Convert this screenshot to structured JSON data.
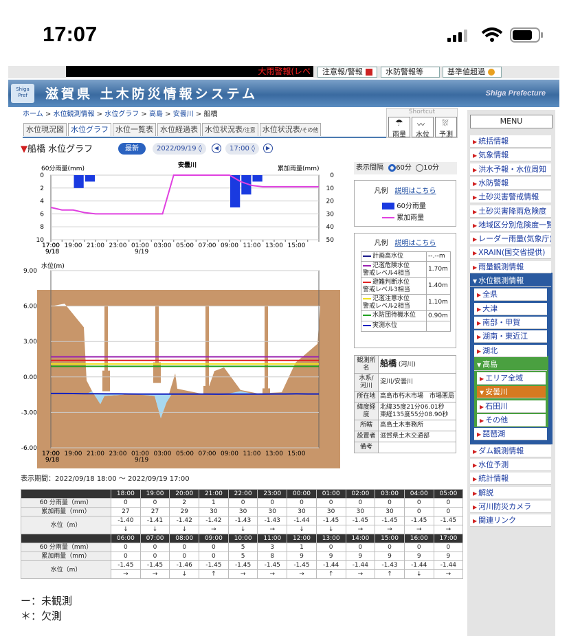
{
  "status": {
    "time": "17:07"
  },
  "topbar": {
    "ticker": "大雨警報(レベ",
    "buttons": [
      "注意報/警報",
      "水防警報等",
      "基準値超過"
    ]
  },
  "banner": {
    "logo": "Shiga Pref",
    "title": "滋賀県 土木防災情報システム",
    "pref": "Shiga Prefecture"
  },
  "breadcrumb": [
    "ホーム",
    "水位観測情報",
    "水位グラフ",
    "高島",
    "安曇川",
    "船橋"
  ],
  "tabs": [
    {
      "label": "水位現況図",
      "sub": ""
    },
    {
      "label": "水位グラフ",
      "sub": ""
    },
    {
      "label": "水位一覧表",
      "sub": ""
    },
    {
      "label": "水位経過表",
      "sub": ""
    },
    {
      "label": "水位状況表",
      "sub": "/注意"
    },
    {
      "label": "水位状況表",
      "sub": "/その他"
    }
  ],
  "shortcut": {
    "label": "Shortcut",
    "items": [
      "雨量",
      "水位",
      "予測"
    ]
  },
  "page": {
    "title": "船橋 水位グラフ",
    "latest": "最新",
    "date": "2022/09/19",
    "time": "17:00",
    "interval_label": "表示間隔",
    "interval_60": "60分",
    "interval_10": "10分"
  },
  "rain_legend": {
    "title": "凡例",
    "link": "説明はこちら",
    "items": [
      "60分雨量",
      "累加雨量"
    ]
  },
  "level_legend": {
    "title": "凡例",
    "link": "説明はこちら",
    "items": [
      {
        "name": "計画高水位",
        "value": "--.--m",
        "color": "#1a1a8a"
      },
      {
        "name": "氾濫危険水位\n警戒レベル4相当",
        "value": "1.70m",
        "color": "#9a20b0"
      },
      {
        "name": "避難判断水位\n警戒レベル3相当",
        "value": "1.40m",
        "color": "#e02020"
      },
      {
        "name": "氾濫注意水位\n警戒レベル2相当",
        "value": "1.10m",
        "color": "#f0e020"
      },
      {
        "name": "水防団待機水位",
        "value": "0.90m",
        "color": "#20a020"
      },
      {
        "name": "実測水位",
        "value": "",
        "color": "#1020c0"
      }
    ]
  },
  "station_info": [
    {
      "k": "観測所名",
      "v": "船橋",
      "v2": "(河川)"
    },
    {
      "k": "水系/河川",
      "v": "淀川/安曇川",
      "v2": ""
    },
    {
      "k": "所在地",
      "v": "高島市朽木市場　市場悪局",
      "v2": ""
    },
    {
      "k": "緯度経度",
      "v": "北緯35度21分06.01秒\n東経135度55分08.90秒",
      "v2": ""
    },
    {
      "k": "所轄",
      "v": "高島土木事務所",
      "v2": ""
    },
    {
      "k": "設置者",
      "v": "滋賀県土木交通部",
      "v2": ""
    },
    {
      "k": "備考",
      "v": "",
      "v2": ""
    }
  ],
  "period": "表示期間：2022/09/18 18:00 〜 2022/09/19 17:00",
  "chart_data": [
    {
      "type": "bar",
      "title": "",
      "river_label": "安曇川",
      "ylabel": "60分雨量(mm)",
      "y2label": "累加雨量(mm)",
      "ylim": [
        0,
        10
      ],
      "y2lim": [
        0,
        50
      ],
      "yticks": [
        "0",
        "2",
        "4",
        "6",
        "8",
        "10"
      ],
      "y2ticks": [
        "0",
        "10",
        "20",
        "30",
        "40",
        "50"
      ],
      "x": [
        "17:00",
        "18:00",
        "19:00",
        "20:00",
        "21:00",
        "22:00",
        "23:00",
        "00:00",
        "01:00",
        "02:00",
        "03:00",
        "04:00",
        "05:00",
        "06:00",
        "07:00",
        "08:00",
        "09:00",
        "10:00",
        "11:00",
        "12:00",
        "13:00",
        "14:00",
        "15:00",
        "16:00",
        "17:00"
      ],
      "xticks": [
        "17:00",
        "19:00",
        "21:00",
        "23:00",
        "01:00",
        "03:00",
        "05:00",
        "07:00",
        "09:00",
        "11:00",
        "13:00",
        "15:00",
        "17:00"
      ],
      "xdates": {
        "17:00": "9/18",
        "01:00": "9/19"
      },
      "series": [
        {
          "name": "60分雨量",
          "values": [
            null,
            0,
            0,
            2,
            1,
            0,
            0,
            0,
            0,
            0,
            0,
            0,
            0,
            0,
            0,
            0,
            0,
            5,
            3,
            1,
            0,
            0,
            0,
            0,
            0
          ],
          "color": "#1a3ae0"
        },
        {
          "name": "累加雨量",
          "values": [
            25,
            27,
            27,
            29,
            30,
            30,
            30,
            30,
            30,
            30,
            30,
            0,
            0,
            0,
            0,
            0,
            0,
            5,
            8,
            9,
            9,
            9,
            9,
            9,
            9
          ],
          "color": "#e040e0"
        }
      ]
    },
    {
      "type": "line",
      "title": "",
      "ylabel": "水位(m)",
      "ylim": [
        -6,
        9
      ],
      "yticks": [
        "9.00",
        "6.00",
        "3.00",
        "0.00",
        "-3.00",
        "-6.00"
      ],
      "x": [
        "17:00",
        "18:00",
        "19:00",
        "20:00",
        "21:00",
        "22:00",
        "23:00",
        "00:00",
        "01:00",
        "02:00",
        "03:00",
        "04:00",
        "05:00",
        "06:00",
        "07:00",
        "08:00",
        "09:00",
        "10:00",
        "11:00",
        "12:00",
        "13:00",
        "14:00",
        "15:00",
        "16:00",
        "17:00"
      ],
      "xticks": [
        "17:00",
        "19:00",
        "21:00",
        "23:00",
        "01:00",
        "03:00",
        "05:00",
        "07:00",
        "09:00",
        "11:00",
        "13:00",
        "15:00",
        "17:00"
      ],
      "xdates": {
        "17:00": "9/18",
        "01:00": "9/19"
      },
      "series": [
        {
          "name": "氾濫危険水位",
          "values": [
            1.7
          ],
          "color": "#9a20b0"
        },
        {
          "name": "避難判断水位",
          "values": [
            1.4
          ],
          "color": "#e02020"
        },
        {
          "name": "氾濫注意水位",
          "values": [
            1.1
          ],
          "color": "#f0e020"
        },
        {
          "name": "水防団待機水位",
          "values": [
            0.9
          ],
          "color": "#20a020"
        },
        {
          "name": "実測水位",
          "values": [
            -1.4,
            -1.4,
            -1.41,
            -1.42,
            -1.42,
            -1.43,
            -1.43,
            -1.44,
            -1.45,
            -1.45,
            -1.45,
            -1.45,
            -1.45,
            -1.45,
            -1.45,
            -1.46,
            -1.45,
            -1.45,
            -1.45,
            -1.45,
            -1.44,
            -1.44,
            -1.43,
            -1.44,
            -1.44
          ],
          "color": "#1020c0"
        }
      ]
    }
  ],
  "table": {
    "row_labels": [
      "60 分雨量（mm）",
      "累加雨量（mm）",
      "水位（m）"
    ],
    "blocks": [
      {
        "hours": [
          "18:00",
          "19:00",
          "20:00",
          "21:00",
          "22:00",
          "23:00",
          "00:00",
          "01:00",
          "02:00",
          "03:00",
          "04:00",
          "05:00"
        ],
        "rain": [
          "0",
          "0",
          "2",
          "1",
          "0",
          "0",
          "0",
          "0",
          "0",
          "0",
          "0",
          "0"
        ],
        "cum": [
          "27",
          "27",
          "29",
          "30",
          "30",
          "30",
          "30",
          "30",
          "30",
          "30",
          "0",
          "0"
        ],
        "level": [
          "-1.40",
          "-1.41",
          "-1.42",
          "-1.42",
          "-1.43",
          "-1.43",
          "-1.44",
          "-1.45",
          "-1.45",
          "-1.45",
          "-1.45",
          "-1.45"
        ],
        "trend": [
          "↓",
          "↓",
          "↓",
          "→",
          "↓",
          "→",
          "↓",
          "↓",
          "→",
          "→",
          "→",
          "→"
        ]
      },
      {
        "hours": [
          "06:00",
          "07:00",
          "08:00",
          "09:00",
          "10:00",
          "11:00",
          "12:00",
          "13:00",
          "14:00",
          "15:00",
          "16:00",
          "17:00"
        ],
        "rain": [
          "0",
          "0",
          "0",
          "0",
          "5",
          "3",
          "1",
          "0",
          "0",
          "0",
          "0",
          "0"
        ],
        "cum": [
          "0",
          "0",
          "0",
          "0",
          "5",
          "8",
          "9",
          "9",
          "9",
          "9",
          "9",
          "9"
        ],
        "level": [
          "-1.45",
          "-1.45",
          "-1.46",
          "-1.45",
          "-1.45",
          "-1.45",
          "-1.45",
          "-1.44",
          "-1.44",
          "-1.43",
          "-1.44",
          "-1.44"
        ],
        "trend": [
          "→",
          "→",
          "↓",
          "↑",
          "→",
          "→",
          "→",
          "↑",
          "→",
          "↑",
          "↓",
          "→"
        ]
      }
    ]
  },
  "notes": [
    "ー：未観測",
    "＊：欠測"
  ],
  "menu": {
    "header": "MENU",
    "items": [
      "統括情報",
      "気象情報",
      "洪水予報・水位周知",
      "水防警報",
      "土砂災害警戒情報",
      "土砂災害降雨危険度",
      "地域区分別危険度一覧",
      "レーダー雨量(気象庁)",
      "XRAIN(国交省提供)",
      "雨量観測情報",
      "水位観測情報"
    ],
    "sub": [
      "全県",
      "大津",
      "南部・甲賀",
      "湖南・東近江",
      "湖北",
      "高島"
    ],
    "sub2": [
      "エリア全域",
      "安曇川",
      "石田川",
      "その他"
    ],
    "sub_after": [
      "琵琶湖"
    ],
    "after": [
      "ダム観測情報",
      "水位予測",
      "統計情報",
      "解説",
      "河川防災カメラ",
      "関連リンク"
    ]
  }
}
